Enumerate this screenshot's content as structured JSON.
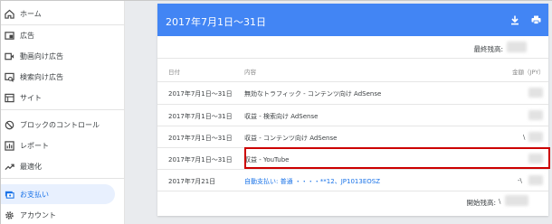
{
  "sidebar": {
    "items": [
      {
        "label": "ホーム",
        "icon": "home-icon"
      },
      {
        "label": "広告",
        "icon": "ads-icon"
      },
      {
        "label": "動画向け広告",
        "icon": "video-ads-icon"
      },
      {
        "label": "検索向け広告",
        "icon": "search-ads-icon"
      },
      {
        "label": "サイト",
        "icon": "sites-icon"
      },
      {
        "label": "ブロックのコントロール",
        "icon": "block-icon"
      },
      {
        "label": "レポート",
        "icon": "reports-icon"
      },
      {
        "label": "最適化",
        "icon": "optimization-icon"
      },
      {
        "label": "お支払い",
        "icon": "payments-icon",
        "active": true
      },
      {
        "label": "アカウント",
        "icon": "account-gear-icon"
      }
    ]
  },
  "card": {
    "title": "2017年7月1日〜31日",
    "final_balance_label": "最終残高:",
    "opening_balance_label": "開始残高:",
    "opening_balance_prefix": "\\",
    "header_color": "#4285f4",
    "columns": {
      "date": "日付",
      "desc": "内容",
      "amount": "金額（JPY）"
    },
    "rows": [
      {
        "date": "2017年7月1日〜31日",
        "desc": "無効なトラフィック - コンテンツ向け AdSense",
        "link": false,
        "amount_prefix": ""
      },
      {
        "date": "2017年7月1日〜31日",
        "desc": "収益 - 検索向け AdSense",
        "link": false,
        "amount_prefix": ""
      },
      {
        "date": "2017年7月1日〜31日",
        "desc": "収益 - コンテンツ向け AdSense",
        "link": false,
        "amount_prefix": "\\"
      },
      {
        "date": "2017年7月1日〜31日",
        "desc": "収益 - YouTube",
        "link": false,
        "amount_prefix": ""
      },
      {
        "date": "2017年7月21日",
        "desc": "自動支払い: 普通 ・・・・**12、JP1013EOSZ",
        "link": true,
        "amount_prefix": "-\\"
      }
    ],
    "highlight_color": "#cc0000"
  }
}
